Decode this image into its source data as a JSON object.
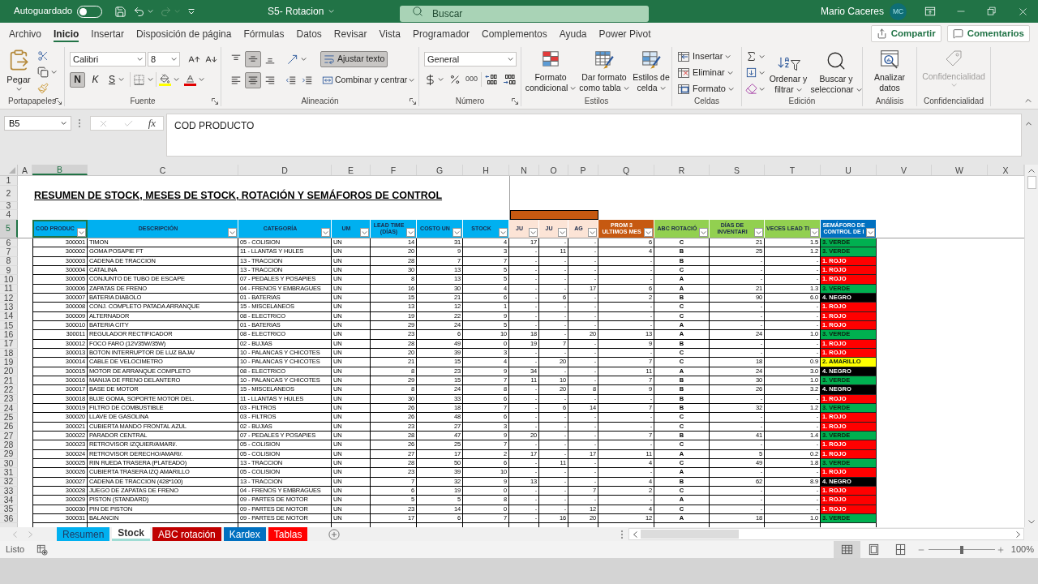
{
  "title_bar": {
    "autosave_label": "Autoguardado",
    "autosave_on": false,
    "redo_disabled": true,
    "document_title": "S5- Rotacion",
    "search": {
      "placeholder": "Buscar"
    },
    "user_name": "Mario Caceres",
    "user_initials": "MC"
  },
  "menu_tabs": [
    {
      "label": "Archivo",
      "selected": false
    },
    {
      "label": "Inicio",
      "selected": true
    },
    {
      "label": "Insertar",
      "selected": false
    },
    {
      "label": "Disposición de página",
      "selected": false
    },
    {
      "label": "Fórmulas",
      "selected": false
    },
    {
      "label": "Datos",
      "selected": false
    },
    {
      "label": "Revisar",
      "selected": false
    },
    {
      "label": "Vista",
      "selected": false
    },
    {
      "label": "Programador",
      "selected": false
    },
    {
      "label": "Complementos",
      "selected": false
    },
    {
      "label": "Ayuda",
      "selected": false
    },
    {
      "label": "Power Pivot",
      "selected": false
    }
  ],
  "share_button": "Compartir",
  "comments_button": "Comentarios",
  "ribbon": {
    "clipboard": {
      "label": "Portapapeles",
      "paste_button": "Pegar"
    },
    "font": {
      "label": "Fuente",
      "font_name": "Calibri",
      "font_size": "8",
      "bold": {
        "label": "N",
        "on": true
      },
      "italic": {
        "label": "K",
        "on": false
      },
      "underline": {
        "label": "S",
        "on": false
      }
    },
    "alignment": {
      "label": "Alineación",
      "vertical": [
        {
          "kind": "top",
          "selected": false
        },
        {
          "kind": "middle",
          "selected": true
        },
        {
          "kind": "bottom",
          "selected": false
        }
      ],
      "horizontal": [
        {
          "kind": "left",
          "selected": false
        },
        {
          "kind": "center",
          "selected": true
        },
        {
          "kind": "right",
          "selected": false
        }
      ],
      "wrap_text": {
        "label": "Ajustar texto",
        "on": true
      },
      "merge_button": "Combinar y centrar"
    },
    "number": {
      "label": "Número",
      "format": "General",
      "comma_button": "000"
    },
    "styles": {
      "label": "Estilos",
      "buttons": [
        {
          "kind": "conditional",
          "label": "Formato condicional"
        },
        {
          "kind": "table",
          "label": "Dar formato como tabla"
        },
        {
          "kind": "cell_styles",
          "label": "Estilos de celda"
        }
      ]
    },
    "cells": {
      "label": "Celdas",
      "buttons": [
        {
          "kind": "insert",
          "label": "Insertar"
        },
        {
          "kind": "delete",
          "label": "Eliminar"
        },
        {
          "kind": "format",
          "label": "Formato"
        }
      ]
    },
    "editing": {
      "label": "Edición",
      "sort_filter_button": "Ordenar y filtrar",
      "find_select_button": "Buscar y seleccionar"
    },
    "analysis": {
      "label": "Análisis",
      "analyze_button": "Analizar datos"
    },
    "sensitivity": {
      "label": "Confidencialidad",
      "button": "Confidencialidad",
      "disabled": true
    }
  },
  "formula_bar": {
    "name_box": "B5",
    "edit_disabled": true,
    "function_label": "fx",
    "formula": "COD PRODUCTO"
  },
  "sheet": {
    "column_headers": [
      {
        "label": "A",
        "selected": false
      },
      {
        "label": "B",
        "selected": true
      },
      {
        "label": "C",
        "selected": false
      },
      {
        "label": "D",
        "selected": false
      },
      {
        "label": "E",
        "selected": false
      },
      {
        "label": "F",
        "selected": false
      },
      {
        "label": "G",
        "selected": false
      },
      {
        "label": "H",
        "selected": false
      },
      {
        "label": "N",
        "selected": false
      },
      {
        "label": "O",
        "selected": false
      },
      {
        "label": "P",
        "selected": false
      },
      {
        "label": "Q",
        "selected": false
      },
      {
        "label": "R",
        "selected": false
      },
      {
        "label": "S",
        "selected": false
      },
      {
        "label": "T",
        "selected": false
      },
      {
        "label": "U",
        "selected": false
      },
      {
        "label": "V",
        "selected": false
      },
      {
        "label": "W",
        "selected": false
      },
      {
        "label": "X",
        "selected": false
      }
    ],
    "row_headers": [
      {
        "label": "1",
        "selected": false
      },
      {
        "label": "2",
        "selected": false
      },
      {
        "label": "3",
        "selected": false
      },
      {
        "label": "4",
        "selected": false
      },
      {
        "label": "5",
        "selected": true
      },
      {
        "label": "6",
        "selected": false
      },
      {
        "label": "7",
        "selected": false
      },
      {
        "label": "8",
        "selected": false
      },
      {
        "label": "9",
        "selected": false
      },
      {
        "label": "10",
        "selected": false
      },
      {
        "label": "11",
        "selected": false
      },
      {
        "label": "12",
        "selected": false
      },
      {
        "label": "13",
        "selected": false
      },
      {
        "label": "14",
        "selected": false
      },
      {
        "label": "15",
        "selected": false
      },
      {
        "label": "16",
        "selected": false
      },
      {
        "label": "17",
        "selected": false
      },
      {
        "label": "18",
        "selected": false
      },
      {
        "label": "19",
        "selected": false
      },
      {
        "label": "20",
        "selected": false
      },
      {
        "label": "21",
        "selected": false
      },
      {
        "label": "22",
        "selected": false
      },
      {
        "label": "23",
        "selected": false
      },
      {
        "label": "24",
        "selected": false
      },
      {
        "label": "25",
        "selected": false
      },
      {
        "label": "26",
        "selected": false
      },
      {
        "label": "27",
        "selected": false
      },
      {
        "label": "28",
        "selected": false
      },
      {
        "label": "29",
        "selected": false
      },
      {
        "label": "30",
        "selected": false
      },
      {
        "label": "31",
        "selected": false
      },
      {
        "label": "32",
        "selected": false
      },
      {
        "label": "33",
        "selected": false
      },
      {
        "label": "34",
        "selected": false
      },
      {
        "label": "35",
        "selected": false
      },
      {
        "label": "36",
        "selected": false
      }
    ],
    "title": "RESUMEN DE STOCK, MESES DE STOCK, ROTACIÓN Y SEMÁFOROS DE CONTROL",
    "table": {
      "columns": [
        {
          "label": "COD PRODUC",
          "color": "#00b0f0",
          "selected": true
        },
        {
          "label": "DESCRIPCIÓN",
          "color": "#00b0f0",
          "selected": false
        },
        {
          "label": "CATEGORÍA",
          "color": "#00b0f0",
          "selected": false
        },
        {
          "label": "UM",
          "color": "#00b0f0",
          "selected": false
        },
        {
          "label": "LEAD TIME (DÍAS)",
          "color": "#00b0f0",
          "selected": false
        },
        {
          "label": "COSTO UN",
          "color": "#00b0f0",
          "selected": false
        },
        {
          "label": "STOCK",
          "color": "#00b0f0",
          "selected": false
        },
        {
          "label": "JU",
          "color": "#fce4d6",
          "selected": false
        },
        {
          "label": "JU",
          "color": "#fce4d6",
          "selected": false
        },
        {
          "label": "AG",
          "color": "#fce4d6",
          "selected": false
        },
        {
          "label": "PROM 3 ULTIMOS MES",
          "color": "#c65911",
          "selected": false
        },
        {
          "label": "ABC ROTACIÓ",
          "color": "#92d050",
          "selected": false
        },
        {
          "label": "DÍAS DE INVENTARI",
          "color": "#92d050",
          "selected": false
        },
        {
          "label": "VECES LEAD TI",
          "color": "#92d050",
          "selected": false
        },
        {
          "label": "SEMÁFORO DE CONTROL DE I",
          "color": "#0070c0",
          "selected": false
        }
      ],
      "rows": [
        {
          "cells": [
            "300001",
            "TIMON",
            "05 - COLISION",
            "UN",
            "14",
            "31",
            "4",
            "17",
            "-",
            "-",
            "6",
            "C",
            "21",
            "1.5",
            "3. VERDE"
          ],
          "color": "#00b050"
        },
        {
          "cells": [
            "300002",
            "GOMA POSAPIE FT",
            "11 - LLANTAS Y HULES",
            "UN",
            "20",
            "9",
            "3",
            "-",
            "11",
            "-",
            "4",
            "B",
            "25",
            "1.2",
            "3. VERDE"
          ],
          "color": "#00b050"
        },
        {
          "cells": [
            "300003",
            "CADENA DE TRACCION",
            "13 - TRACCION",
            "UN",
            "28",
            "7",
            "7",
            "-",
            "-",
            "-",
            "-",
            "B",
            "-",
            "-",
            "1. ROJO"
          ],
          "color": "#ff0000"
        },
        {
          "cells": [
            "300004",
            "CATALINA",
            "13 - TRACCION",
            "UN",
            "30",
            "13",
            "5",
            "-",
            "-",
            "-",
            "-",
            "C",
            "-",
            "-",
            "1. ROJO"
          ],
          "color": "#ff0000"
        },
        {
          "cells": [
            "300005",
            "CONJUNTO DE TUBO DE ESCAPE",
            "07 - PEDALES Y POSAPIES",
            "UN",
            "8",
            "13",
            "5",
            "-",
            "-",
            "-",
            "-",
            "A",
            "-",
            "-",
            "1. ROJO"
          ],
          "color": "#ff0000"
        },
        {
          "cells": [
            "300006",
            "ZAPATAS DE FRENO",
            "04 - FRENOS Y EMBRAGUES",
            "UN",
            "16",
            "30",
            "4",
            "-",
            "-",
            "17",
            "6",
            "A",
            "21",
            "1.3",
            "3. VERDE"
          ],
          "color": "#00b050"
        },
        {
          "cells": [
            "300007",
            "BATERIA DIABOLO",
            "01 - BATERIAS",
            "UN",
            "15",
            "21",
            "6",
            "-",
            "6",
            "-",
            "2",
            "B",
            "90",
            "6.0",
            "4. NEGRO"
          ],
          "color": "#000000"
        },
        {
          "cells": [
            "300008",
            "CONJ. COMPLETO PATADA ARRANQUE",
            "15 - MISCELANEOS",
            "UN",
            "13",
            "12",
            "1",
            "-",
            "-",
            "-",
            "-",
            "C",
            "-",
            "-",
            "1. ROJO"
          ],
          "color": "#ff0000"
        },
        {
          "cells": [
            "300009",
            "ALTERNADOR",
            "08 - ELECTRICO",
            "UN",
            "19",
            "22",
            "9",
            "-",
            "-",
            "-",
            "-",
            "C",
            "-",
            "-",
            "1. ROJO"
          ],
          "color": "#ff0000"
        },
        {
          "cells": [
            "300010",
            "BATERIA CITY",
            "01 - BATERIAS",
            "UN",
            "29",
            "24",
            "5",
            "-",
            "-",
            "-",
            "-",
            "A",
            "-",
            "-",
            "1. ROJO"
          ],
          "color": "#ff0000"
        },
        {
          "cells": [
            "300011",
            "REGULADOR RECTIFICADOR",
            "08 - ELECTRICO",
            "UN",
            "23",
            "6",
            "10",
            "18",
            "-",
            "20",
            "13",
            "A",
            "24",
            "1.0",
            "3. VERDE"
          ],
          "color": "#00b050"
        },
        {
          "cells": [
            "300012",
            "FOCO FARO (12V35W/35W)",
            "02 - BUJIAS",
            "UN",
            "28",
            "49",
            "0",
            "19",
            "7",
            "-",
            "9",
            "B",
            "-",
            "-",
            "1. ROJO"
          ],
          "color": "#ff0000"
        },
        {
          "cells": [
            "300013",
            "BOTON INTERRUPTOR DE LUZ BAJA/",
            "10 - PALANCAS Y CHICOTES",
            "UN",
            "20",
            "39",
            "3",
            "-",
            "-",
            "-",
            "-",
            "C",
            "-",
            "-",
            "1. ROJO"
          ],
          "color": "#ff0000"
        },
        {
          "cells": [
            "300014",
            "CABLE DE VELOCIMETRO",
            "10 - PALANCAS Y CHICOTES",
            "UN",
            "21",
            "15",
            "4",
            "-",
            "20",
            "-",
            "7",
            "C",
            "18",
            "0.9",
            "2. AMARILLO"
          ],
          "color": "#ffff00"
        },
        {
          "cells": [
            "300015",
            "MOTOR DE ARRANQUE COMPLETO",
            "08 - ELECTRICO",
            "UN",
            "8",
            "23",
            "9",
            "34",
            "-",
            "-",
            "11",
            "A",
            "24",
            "3.0",
            "4. NEGRO"
          ],
          "color": "#000000"
        },
        {
          "cells": [
            "300016",
            "MANIJA DE FRENO DELANTERO",
            "10 - PALANCAS Y CHICOTES",
            "UN",
            "29",
            "15",
            "7",
            "11",
            "10",
            "-",
            "7",
            "B",
            "30",
            "1.0",
            "3. VERDE"
          ],
          "color": "#00b050"
        },
        {
          "cells": [
            "300017",
            "BASE DE MOTOR",
            "15 - MISCELANEOS",
            "UN",
            "8",
            "24",
            "8",
            "-",
            "20",
            "8",
            "9",
            "B",
            "26",
            "3.2",
            "4. NEGRO"
          ],
          "color": "#000000"
        },
        {
          "cells": [
            "300018",
            "BUJE GOMA, SOPORTE MOTOR DEL.",
            "11 - LLANTAS Y HULES",
            "UN",
            "30",
            "33",
            "6",
            "-",
            "-",
            "-",
            "-",
            "B",
            "-",
            "-",
            "1. ROJO"
          ],
          "color": "#ff0000"
        },
        {
          "cells": [
            "300019",
            "FILTRO DE COMBUSTIBLE",
            "03 - FILTROS",
            "UN",
            "26",
            "18",
            "7",
            "-",
            "6",
            "14",
            "7",
            "B",
            "32",
            "1.2",
            "3. VERDE"
          ],
          "color": "#00b050"
        },
        {
          "cells": [
            "300020",
            "LLAVE DE GASOLINA",
            "03 - FILTROS",
            "UN",
            "26",
            "48",
            "6",
            "-",
            "-",
            "-",
            "-",
            "C",
            "-",
            "-",
            "1. ROJO"
          ],
          "color": "#ff0000"
        },
        {
          "cells": [
            "300021",
            "CUBIERTA MANDO FRONTAL AZUL",
            "02 - BUJIAS",
            "UN",
            "23",
            "27",
            "3",
            "-",
            "-",
            "-",
            "-",
            "C",
            "-",
            "-",
            "1. ROJO"
          ],
          "color": "#ff0000"
        },
        {
          "cells": [
            "300022",
            "PARADOR CENTRAL",
            "07 - PEDALES Y POSAPIES",
            "UN",
            "28",
            "47",
            "9",
            "20",
            "-",
            "-",
            "7",
            "B",
            "41",
            "1.4",
            "3. VERDE"
          ],
          "color": "#00b050"
        },
        {
          "cells": [
            "300023",
            "RETROVISOR IZQUIER/AMARI/.",
            "05 - COLISION",
            "UN",
            "26",
            "25",
            "7",
            "-",
            "-",
            "-",
            "-",
            "C",
            "-",
            "-",
            "1. ROJO"
          ],
          "color": "#ff0000"
        },
        {
          "cells": [
            "300024",
            "RETROVISOR DERECHO/AMARI/.",
            "05 - COLISION",
            "UN",
            "27",
            "17",
            "2",
            "17",
            "-",
            "17",
            "11",
            "A",
            "5",
            "0.2",
            "1. ROJO"
          ],
          "color": "#ff0000"
        },
        {
          "cells": [
            "300025",
            "RIN RUEDA TRASERA (PLATEADO)",
            "13 - TRACCION",
            "UN",
            "28",
            "50",
            "6",
            "-",
            "11",
            "-",
            "4",
            "C",
            "49",
            "1.8",
            "3. VERDE"
          ],
          "color": "#00b050"
        },
        {
          "cells": [
            "300026",
            "CUBIERTA TRASERA IZQ AMARILLO",
            "05 - COLISION",
            "UN",
            "23",
            "39",
            "10",
            "-",
            "-",
            "-",
            "-",
            "A",
            "-",
            "-",
            "1. ROJO"
          ],
          "color": "#ff0000"
        },
        {
          "cells": [
            "300027",
            "CADENA DE TRACCION (428*100)",
            "13 - TRACCION",
            "UN",
            "7",
            "32",
            "9",
            "13",
            "-",
            "-",
            "4",
            "B",
            "62",
            "8.9",
            "4. NEGRO"
          ],
          "color": "#000000"
        },
        {
          "cells": [
            "300028",
            "JUEGO DE ZAPATAS DE FRENO",
            "04 - FRENOS Y EMBRAGUES",
            "UN",
            "6",
            "19",
            "0",
            "-",
            "-",
            "7",
            "2",
            "C",
            "-",
            "-",
            "1. ROJO"
          ],
          "color": "#ff0000"
        },
        {
          "cells": [
            "300029",
            "PISTON (STANDARD)",
            "09 - PARTES DE MOTOR",
            "UN",
            "5",
            "5",
            "8",
            "-",
            "-",
            "-",
            "-",
            "A",
            "-",
            "-",
            "1. ROJO"
          ],
          "color": "#ff0000"
        },
        {
          "cells": [
            "300030",
            "PIN DE PISTON",
            "09 - PARTES DE MOTOR",
            "UN",
            "23",
            "14",
            "0",
            "-",
            "-",
            "12",
            "4",
            "C",
            "-",
            "-",
            "1. ROJO"
          ],
          "color": "#ff0000"
        },
        {
          "cells": [
            "300031",
            "BALANCIN",
            "09 - PARTES DE MOTOR",
            "UN",
            "17",
            "6",
            "7",
            "-",
            "16",
            "20",
            "12",
            "A",
            "18",
            "1.0",
            "3. VERDE"
          ],
          "color": "#00b050"
        }
      ]
    }
  },
  "sheet_tabs": {
    "nav_disabled": true,
    "tabs": [
      {
        "label": "Resumen",
        "color": "#00b0f0",
        "selected": false
      },
      {
        "label": "Stock",
        "color": "#9fdcd4",
        "selected": true
      },
      {
        "label": "ABC rotación",
        "color": "#c00000",
        "selected": false
      },
      {
        "label": "Kardex",
        "color": "#0070c0",
        "selected": false
      },
      {
        "label": "Tablas",
        "color": "#ff0000",
        "selected": false
      }
    ]
  },
  "status_bar": {
    "status_text": "Listo",
    "views": [
      {
        "kind": "normal",
        "selected": true
      },
      {
        "kind": "page_layout",
        "selected": false
      },
      {
        "kind": "page_break",
        "selected": false
      }
    ],
    "zoom": {
      "level": 0.5,
      "label": "100%"
    }
  }
}
